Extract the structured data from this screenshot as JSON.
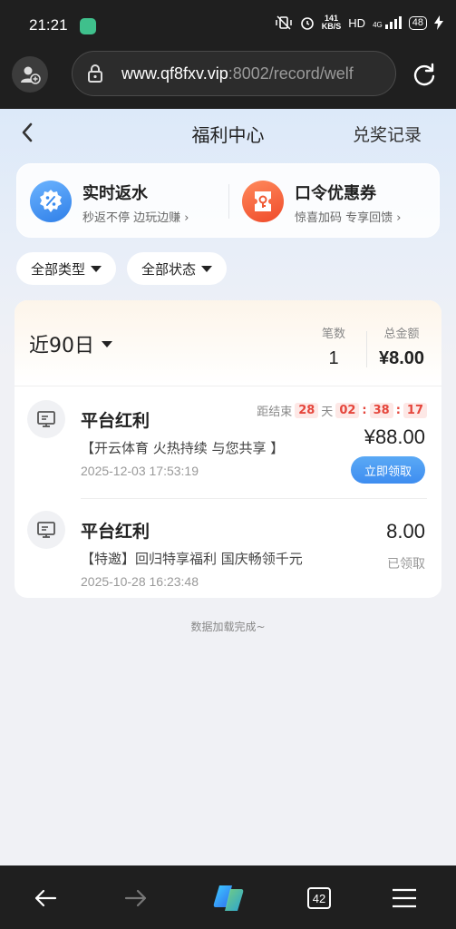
{
  "status_bar": {
    "time": "21:21",
    "net_speed_value": "141",
    "net_speed_unit": "KB/S",
    "hd_label": "HD",
    "network": "4G",
    "battery": "48"
  },
  "browser": {
    "url_host": "www.qf8fxv.vip",
    "url_path": ":8002/record/welf",
    "tab_count": "42"
  },
  "nav": {
    "title": "福利中心",
    "right_link": "兑奖记录"
  },
  "promos": [
    {
      "title": "实时返水",
      "subtitle": "秒返不停 边玩边赚 ›",
      "icon": "percent-badge-icon",
      "color": "#3a8cf0"
    },
    {
      "title": "口令优惠券",
      "subtitle": "惊喜加码 专享回馈 ›",
      "icon": "coupon-ticket-icon",
      "color": "#f05a34"
    }
  ],
  "filters": {
    "type": "全部类型",
    "status": "全部状态"
  },
  "summary": {
    "period": "近90日",
    "count_label": "笔数",
    "count_value": "1",
    "total_label": "总金额",
    "total_value": "¥8.00"
  },
  "records": [
    {
      "title": "平台红利",
      "description": "【开云体育 火热持续 与您共享 】",
      "date": "2025-12-03 17:53:19",
      "amount": "¥88.00",
      "countdown": {
        "prefix": "距结束",
        "days": "28",
        "day_unit": "天",
        "hours": "02",
        "minutes": "38",
        "seconds": "17"
      },
      "action": "立即领取"
    },
    {
      "title": "平台红利",
      "description": "【特邀】回归特享福利 国庆畅领千元",
      "date": "2025-10-28 16:23:48",
      "amount": "8.00",
      "status": "已领取"
    }
  ],
  "footer_text": "数据加载完成~",
  "colors": {
    "accent_blue": "#3e8df0",
    "countdown_red": "#e5463c",
    "browser_dark": "#1f1f1f"
  }
}
